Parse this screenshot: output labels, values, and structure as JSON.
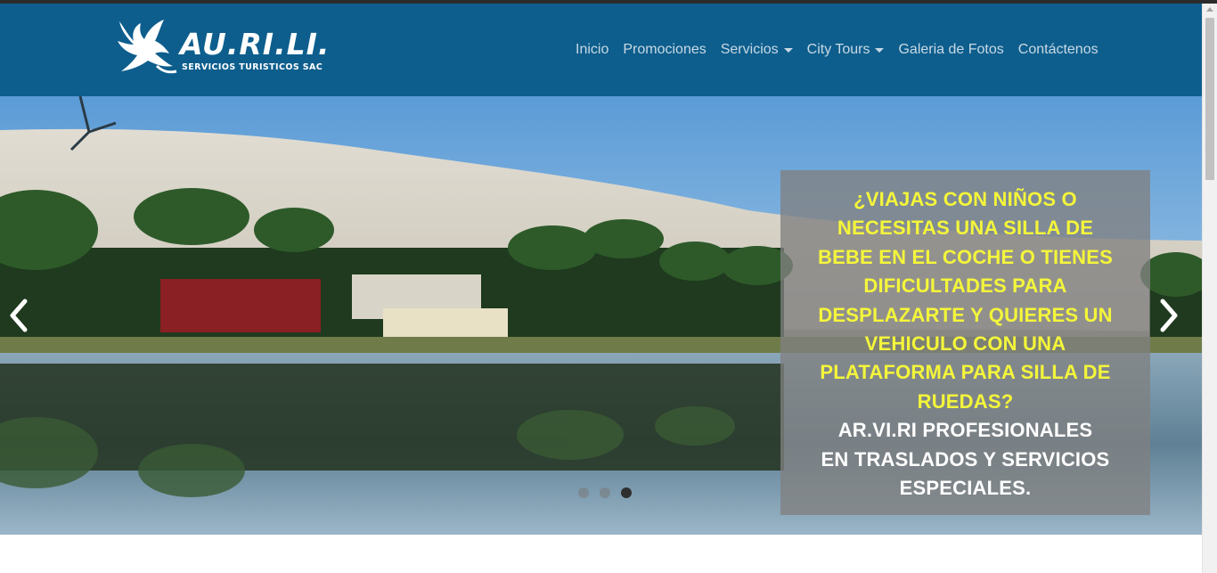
{
  "brand": {
    "name": "AU.RI.LI.",
    "subtitle": "SERVICIOS TURISTICOS SAC",
    "logo_icon": "dove-icon"
  },
  "nav": {
    "items": [
      {
        "label": "Inicio",
        "dropdown": false
      },
      {
        "label": "Promociones",
        "dropdown": false
      },
      {
        "label": "Servicios",
        "dropdown": true
      },
      {
        "label": "City Tours",
        "dropdown": true
      },
      {
        "label": "Galeria de Fotos",
        "dropdown": false
      },
      {
        "label": "Contáctenos",
        "dropdown": false
      }
    ]
  },
  "carousel": {
    "caption_lines_yellow": [
      "¿VIAJAS CON NIÑOS O",
      "NECESITAS UNA SILLA DE",
      "BEBE EN EL COCHE O TIENES",
      "DIFICULTADES PARA",
      "DESPLAZARTE Y QUIERES UN",
      "VEHICULO CON UNA",
      "PLATAFORMA PARA SILLA DE",
      "RUEDAS?"
    ],
    "caption_lines_white": [
      "AR.VI.RI PROFESIONALES",
      "EN TRASLADOS Y SERVICIOS",
      "ESPECIALES."
    ],
    "slide_count": 3,
    "active_slide": 3,
    "prev_icon": "chevron-left-icon",
    "next_icon": "chevron-right-icon"
  },
  "colors": {
    "navbar": "#0d5e8d",
    "nav_text": "#c9d9e4",
    "caption_yellow": "#f4f63a",
    "caption_bg": "#808080"
  }
}
